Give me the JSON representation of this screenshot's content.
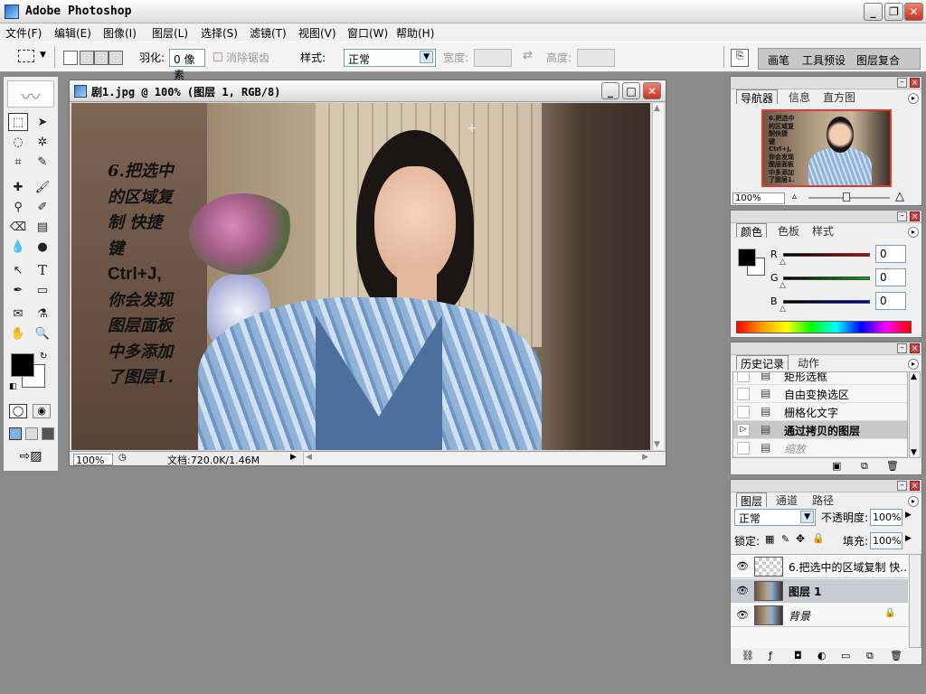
{
  "app": {
    "title": "Adobe Photoshop"
  },
  "window_controls": {
    "minimize": "_",
    "restore": "❐",
    "close": "✕"
  },
  "menu": [
    "文件(F)",
    "编辑(E)",
    "图像(I)",
    "图层(L)",
    "选择(S)",
    "滤镜(T)",
    "视图(V)",
    "窗口(W)",
    "帮助(H)"
  ],
  "options": {
    "feather_label": "羽化:",
    "feather_value": "0 像素",
    "antialias_label": "消除锯齿",
    "style_label": "样式:",
    "style_value": "正常",
    "width_label": "宽度:",
    "height_label": "高度:",
    "well_tabs": [
      "画笔",
      "工具预设",
      "图层复合"
    ]
  },
  "document": {
    "title": "剧1.jpg @ 100% (图层 1, RGB/8)",
    "zoom": "100%",
    "doc_size": "文档:720.0K/1.46M",
    "overlay_text": [
      "6.把选中",
      "的区域复",
      "制 快捷",
      "键",
      "Ctrl+J,",
      "你会发现",
      "图层面板",
      "中多添加",
      "了图层1."
    ]
  },
  "navigator": {
    "tabs": [
      "导航器",
      "信息",
      "直方图"
    ],
    "zoom": "100%",
    "thumb_text": [
      "6.把选中",
      "的区域复",
      "制快捷",
      "键",
      "Ctrl+J,",
      "你会发现",
      "图层面板",
      "中多添加",
      "了图层1."
    ]
  },
  "color": {
    "tabs": [
      "颜色",
      "色板",
      "样式"
    ],
    "channels": [
      {
        "label": "R",
        "value": "0",
        "color": "#d40000"
      },
      {
        "label": "G",
        "value": "0",
        "color": "#00b000"
      },
      {
        "label": "B",
        "value": "0",
        "color": "#0000d0"
      }
    ]
  },
  "history": {
    "tabs": [
      "历史记录",
      "动作"
    ],
    "items": [
      {
        "label": "矩形选框",
        "state": "normal"
      },
      {
        "label": "自由变换选区",
        "state": "normal"
      },
      {
        "label": "栅格化文字",
        "state": "normal"
      },
      {
        "label": "通过拷贝的图层",
        "state": "active"
      },
      {
        "label": "缩放",
        "state": "dimmed"
      }
    ]
  },
  "layers": {
    "tabs": [
      "图层",
      "通道",
      "路径"
    ],
    "blend_mode": "正常",
    "opacity_label": "不透明度:",
    "opacity_value": "100%",
    "lock_label": "锁定:",
    "fill_label": "填充:",
    "fill_value": "100%",
    "items": [
      {
        "name": "6.把选中的区域复制 快...",
        "type": "text",
        "selected": false
      },
      {
        "name": "图层 1",
        "type": "image",
        "selected": true
      },
      {
        "name": "背景",
        "type": "background",
        "selected": false
      }
    ]
  }
}
